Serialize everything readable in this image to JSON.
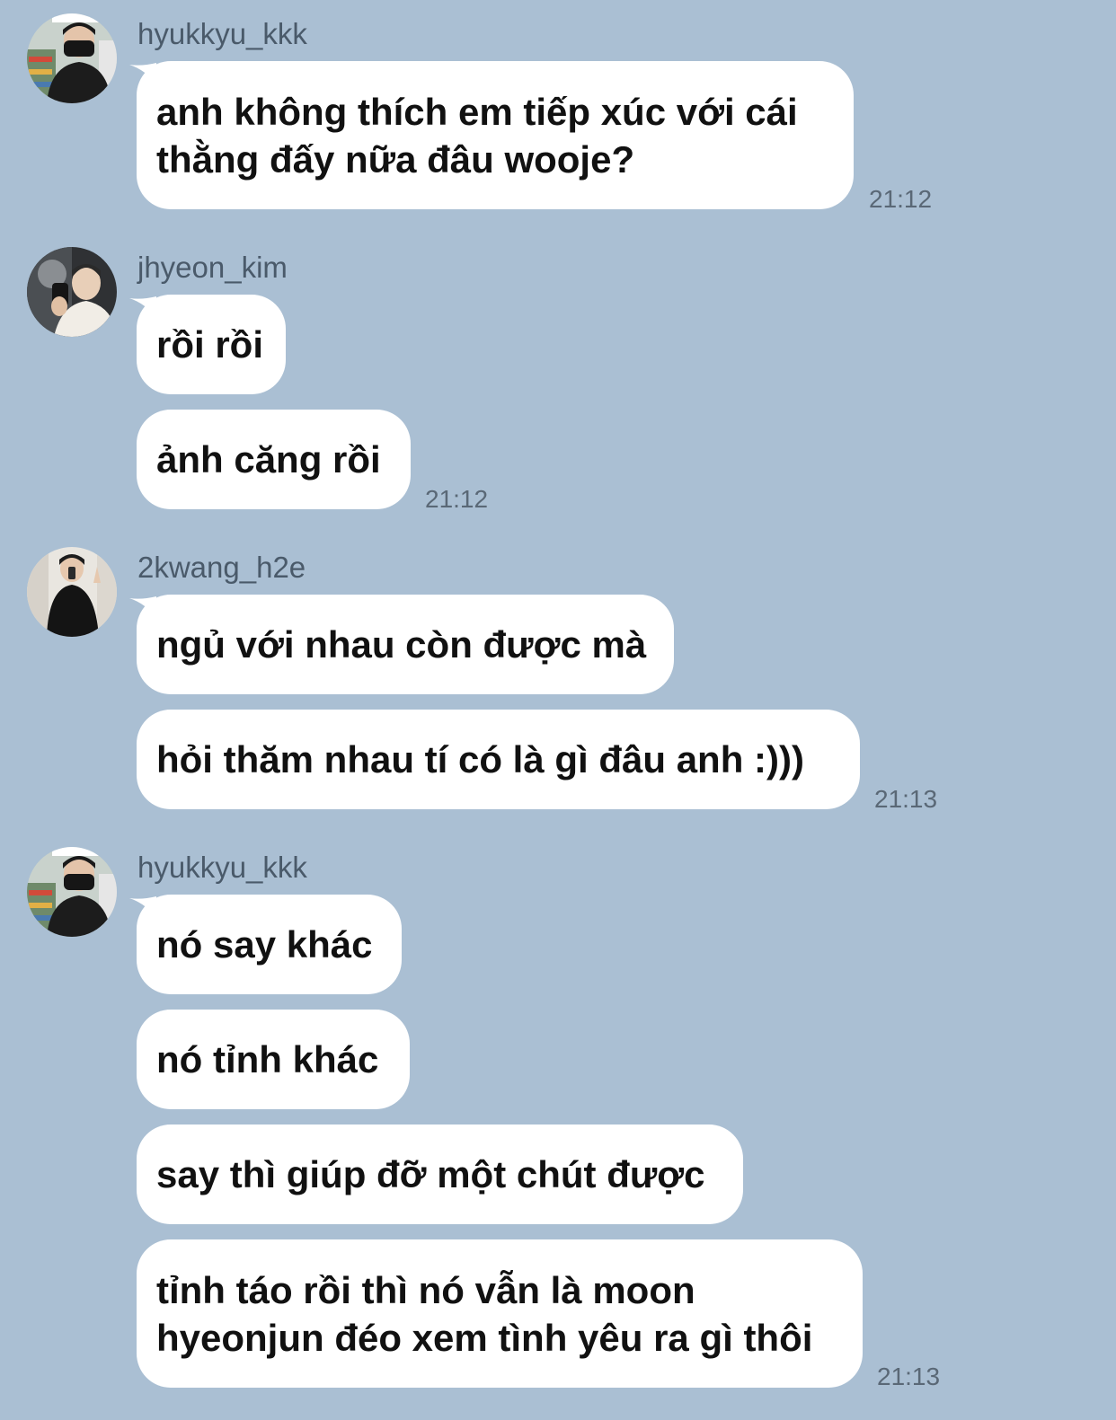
{
  "chat": {
    "groups": [
      {
        "sender": "hyukkyu_kkk",
        "avatar_icon": "profile-photo-masked-man",
        "messages": [
          "anh không thích em tiếp xúc với cái thằng đấy nữa đâu wooje?"
        ],
        "time": "21:12"
      },
      {
        "sender": "jhyeon_kim",
        "avatar_icon": "profile-photo-mirror-selfie",
        "messages": [
          "rồi rồi",
          "ảnh căng rồi"
        ],
        "time": "21:12"
      },
      {
        "sender": "2kwang_h2e",
        "avatar_icon": "profile-photo-suit-selfie",
        "messages": [
          "ngủ với nhau còn được mà",
          "hỏi thăm nhau tí có là gì đâu anh :)))"
        ],
        "time": "21:13"
      },
      {
        "sender": "hyukkyu_kkk",
        "avatar_icon": "profile-photo-masked-man",
        "messages": [
          "nó say khác",
          "nó tỉnh khác",
          "say thì giúp đỡ một chút được",
          "tỉnh táo rồi thì nó vẫn là moon hyeonjun đéo xem tình yêu ra gì thôi"
        ],
        "time": "21:13"
      }
    ]
  },
  "colors": {
    "background": "#aabfd3",
    "bubble": "#ffffff",
    "message_text": "#111111",
    "sender_text": "#4a5a6a",
    "time_text": "#5a6876"
  }
}
